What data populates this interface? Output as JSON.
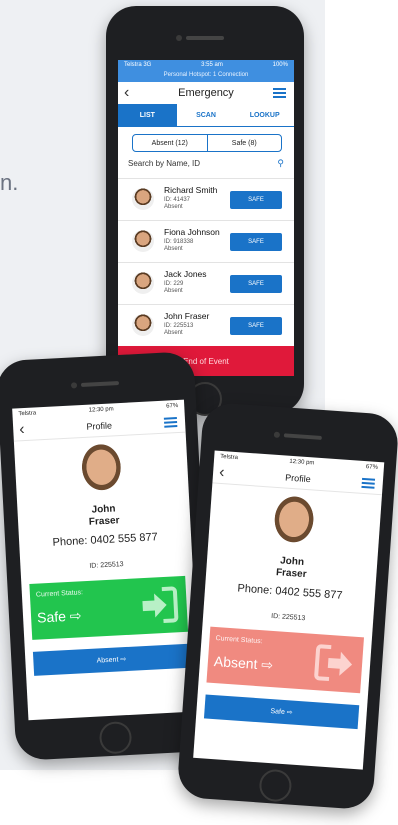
{
  "background_fragment": "n.",
  "main_phone": {
    "status": {
      "carrier": "Telstra 3G",
      "time": "3:55 am",
      "battery": "100%",
      "hotspot": "Personal Hotspot: 1 Connection"
    },
    "title": "Emergency",
    "tabs": [
      "LIST",
      "SCAN",
      "LOOKUP"
    ],
    "segments": [
      "Absent (12)",
      "Safe (8)"
    ],
    "search_placeholder": "Search by Name, ID",
    "people": [
      {
        "name": "Richard Smith",
        "id": "ID: 41437",
        "status": "Absent",
        "button": "SAFE"
      },
      {
        "name": "Fiona Johnson",
        "id": "ID: 918338",
        "status": "Absent",
        "button": "SAFE"
      },
      {
        "name": "Jack Jones",
        "id": "ID: 229",
        "status": "Absent",
        "button": "SAFE"
      },
      {
        "name": "John Fraser",
        "id": "ID: 225513",
        "status": "Absent",
        "button": "SAFE"
      }
    ],
    "footer": "End of Event"
  },
  "left_phone": {
    "status": {
      "carrier": "Telstra",
      "time": "12:30 pm",
      "battery": "67%"
    },
    "title": "Profile",
    "first_name": "John",
    "last_name": "Fraser",
    "phone": "Phone: 0402 555 877",
    "id": "ID: 225513",
    "status_label": "Current Status:",
    "status_value": "Safe",
    "action": "Absent",
    "colors": {
      "status": "#22c54e",
      "action": "#1a73c8"
    }
  },
  "right_phone": {
    "status": {
      "carrier": "Telstra",
      "time": "12:30 pm",
      "battery": "67%"
    },
    "title": "Profile",
    "first_name": "John",
    "last_name": "Fraser",
    "phone": "Phone: 0402 555 877",
    "id": "ID: 225513",
    "status_label": "Current Status:",
    "status_value": "Absent",
    "action": "Safe",
    "colors": {
      "status": "#f08a80",
      "action": "#1a73c8"
    }
  }
}
